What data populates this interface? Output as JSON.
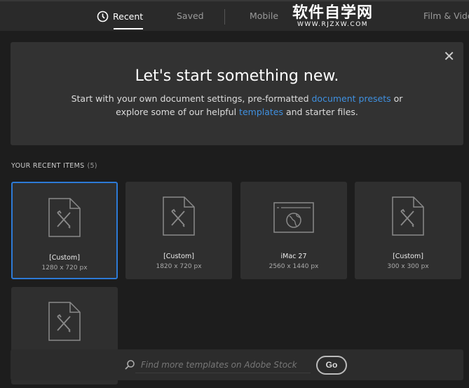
{
  "tabs": [
    {
      "label": "Recent",
      "active": true
    },
    {
      "label": "Saved"
    },
    {
      "label": "Mobile"
    },
    {
      "label": "Film & Vide"
    }
  ],
  "watermark": {
    "title": "软件自学网",
    "url": "WWW.RJZXW.COM"
  },
  "hero": {
    "title": "Let's start something new.",
    "line1_pre": "Start with your own document settings, pre-formatted ",
    "line1_link": "document presets",
    "line1_post": " or",
    "line2_pre": "explore some of our helpful ",
    "line2_link": "templates",
    "line2_post": " and starter files."
  },
  "recent": {
    "label": "YOUR RECENT ITEMS",
    "count": "(5)",
    "items": [
      {
        "name": "[Custom]",
        "size": "1280 x 720 px"
      },
      {
        "name": "[Custom]",
        "size": "1820 x 720 px"
      },
      {
        "name": "iMac 27",
        "size": "2560 x 1440 px"
      },
      {
        "name": "[Custom]",
        "size": "300 x 300 px"
      },
      {
        "name": "",
        "size": ""
      }
    ]
  },
  "search": {
    "placeholder": "Find more templates on Adobe Stock",
    "go": "Go"
  },
  "colors": {
    "accent": "#2d7ad6",
    "link": "#3f90e0"
  }
}
